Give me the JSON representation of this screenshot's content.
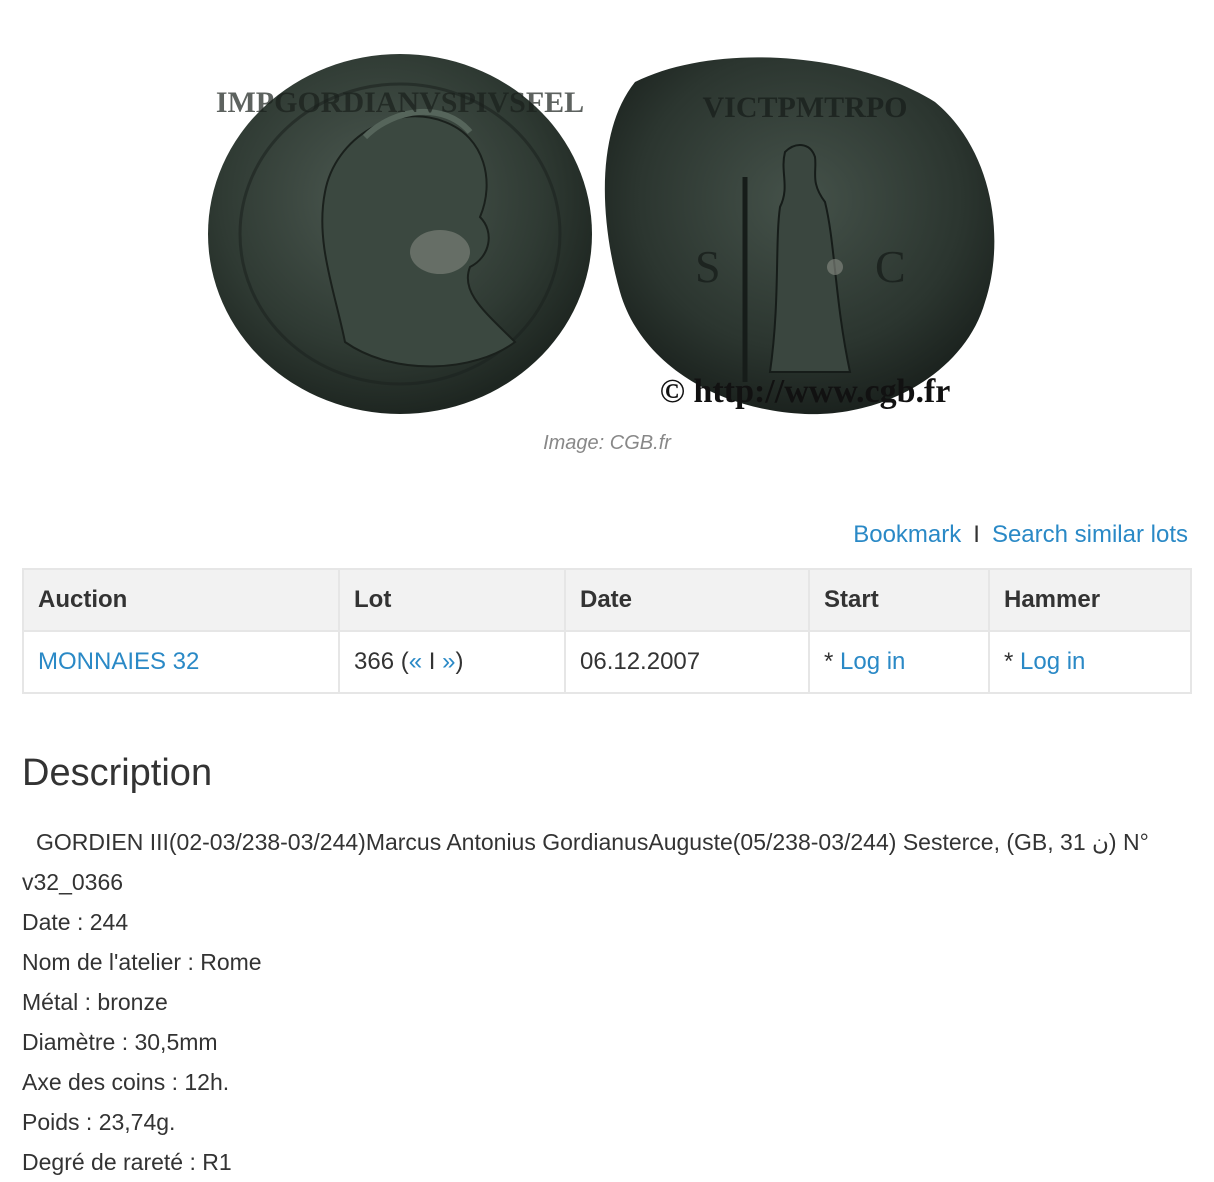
{
  "image": {
    "watermark": "© http://www.cgb.fr",
    "caption": "Image: CGB.fr"
  },
  "actions": {
    "bookmark": "Bookmark",
    "separator": "I",
    "search_similar": "Search similar lots"
  },
  "table": {
    "headers": [
      "Auction",
      "Lot",
      "Date",
      "Start",
      "Hammer"
    ],
    "row": {
      "auction": "MONNAIES 32",
      "lot_number": "366 (",
      "lot_prev": "«",
      "lot_sep": " I ",
      "lot_next": "»",
      "lot_close": ")",
      "date": "06.12.2007",
      "start_prefix": "* ",
      "start_link": "Log in",
      "hammer_prefix": "* ",
      "hammer_link": "Log in"
    }
  },
  "description": {
    "heading": "Description",
    "lines": [
      "GORDIEN III(02-03/238-03/244)Marcus Antonius GordianusAuguste(05/238-03/244) Sesterce, (GB, 31 ن) N° v32_0366",
      "Date : 244",
      "Nom de l'atelier : Rome",
      "Métal : bronze",
      "Diamètre : 30,5mm",
      "Axe des coins : 12h.",
      "Poids : 23,74g.",
      "Degré de rareté : R1"
    ]
  },
  "colors": {
    "link": "#2a89c6",
    "coin_patina": "#2f3a33",
    "header_bg": "#f2f2f2"
  }
}
